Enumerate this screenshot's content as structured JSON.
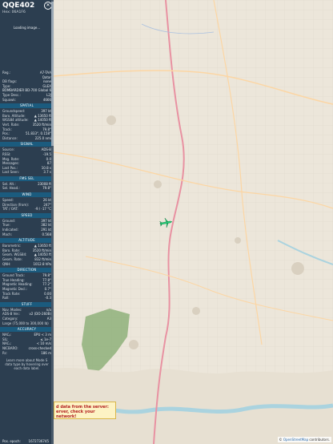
{
  "aircraft": {
    "callsign": "QQE402",
    "hex_label": "Hex: 06A1F6",
    "photo_status": "Loading image..."
  },
  "details": [
    {
      "label": "Reg.:",
      "value": "A7-TAA"
    },
    {
      "label": "",
      "value": "Qatar"
    },
    {
      "label": "DB flags:",
      "value": "none"
    },
    {
      "label": "Type:",
      "value": "GLEX"
    },
    {
      "label": "",
      "value": "BOMBARDIER BD-700 Global 6000/6500"
    },
    {
      "label": "Type Desc.:",
      "value": "L2J"
    },
    {
      "label": "Squawk:",
      "value": "4666"
    }
  ],
  "sections": [
    {
      "title": "SPATIAL",
      "rows": [
        {
          "label": "Groundspeed:",
          "value": "397 kt"
        },
        {
          "label": "Baro. Altitude:",
          "value": "▲ 13650 ft"
        },
        {
          "label": "WGS84 altitude:",
          "value": "▲ 14050 ft"
        },
        {
          "label": "Vert. Rate:",
          "value": "3520 ft/min"
        },
        {
          "label": "Track:",
          "value": "79.8°"
        },
        {
          "label": "Pos.:",
          "value": "51.833°, 0.158°"
        },
        {
          "label": "Distance:",
          "value": "225.0 nmi"
        }
      ]
    },
    {
      "title": "SIGNAL",
      "rows": [
        {
          "label": "Source:",
          "value": "ADS-B"
        },
        {
          "label": "RSSI:",
          "value": "-19.5"
        },
        {
          "label": "Msg. Rate:",
          "value": "0.0"
        },
        {
          "label": "Messages:",
          "value": "87"
        },
        {
          "label": "Last Pos.:",
          "value": "10.8 s"
        },
        {
          "label": "Last Seen:",
          "value": "3.7 s"
        }
      ]
    },
    {
      "title": "FMS SEL",
      "rows": [
        {
          "label": "Sel. Alt.:",
          "value": "23008 ft"
        },
        {
          "label": "Sel. Head.:",
          "value": "79.8°"
        }
      ]
    },
    {
      "title": "WIND",
      "rows": [
        {
          "label": "Speed:",
          "value": "26 kt"
        },
        {
          "label": "Direction (from):",
          "value": "247°"
        },
        {
          "label": "TAT / OAT:",
          "value": "-9 / -17 °C"
        }
      ]
    },
    {
      "title": "SPEED",
      "rows": [
        {
          "label": "Ground:",
          "value": "397 kt"
        },
        {
          "label": "True:",
          "value": "382 kt"
        },
        {
          "label": "Indicated:",
          "value": "291 kt"
        },
        {
          "label": "Mach:",
          "value": "0.568"
        }
      ]
    },
    {
      "title": "ALTITUDE",
      "rows": [
        {
          "label": "Barometric:",
          "value": "▲ 13650 ft"
        },
        {
          "label": "Baro. Rate:",
          "value": "3520 ft/min"
        },
        {
          "label": "Geom. WGS84:",
          "value": "▲ 14050 ft"
        },
        {
          "label": "Geom. Rate:",
          "value": "832 ft/min"
        },
        {
          "label": "QNH:",
          "value": "1012.8 hPa"
        }
      ]
    },
    {
      "title": "DIRECTION",
      "rows": [
        {
          "label": "Ground Track:",
          "value": "79.8°"
        },
        {
          "label": "True Heading:",
          "value": "77.8°"
        },
        {
          "label": "Magnetic Heading:",
          "value": "77.2°"
        },
        {
          "label": "Magnetic Decl.:",
          "value": "0.7°"
        },
        {
          "label": "Track Rate:",
          "value": "0.00"
        },
        {
          "label": "Roll:",
          "value": "-0.3"
        }
      ]
    },
    {
      "title": "STUFF",
      "rows": [
        {
          "label": "Nav. Modes:",
          "value": "n/a"
        },
        {
          "label": "ADS-B Ver.:",
          "value": "v2 (DO-260B)"
        },
        {
          "label": "Category:",
          "value": "A3"
        },
        {
          "label": "Large (75,000 to 300,000 lb)",
          "value": ""
        }
      ]
    },
    {
      "title": "ACCURACY",
      "rows": [
        {
          "label": "NACₚ:",
          "value": "EPU < 3 m"
        },
        {
          "label": "SIL:",
          "value": "≤ 1e-7"
        },
        {
          "label": "NACᵥ:",
          "value": "< 10 m/s"
        },
        {
          "label": "NICBARO:",
          "value": "cross-checked"
        },
        {
          "label": "Rc:",
          "value": "186 m"
        }
      ]
    }
  ],
  "note": "Learn more about Mode S data type by hovering over each data label.",
  "epoch": {
    "label": "Pos. epoch:",
    "value": "1672736745"
  },
  "error": "d data from the server: erver, check your network!",
  "attribution": {
    "symbol": "©",
    "link": "OpenStreetMap",
    "text": "contributors."
  },
  "aircraft_marker": {
    "track_deg": 79.8,
    "color": "#25d17a"
  },
  "colors": {
    "sidebar": "#2c3e50",
    "section": "#1b5b7e",
    "map_land": "#ece6da",
    "water": "#aad3df",
    "forest": "#8fb07a"
  }
}
